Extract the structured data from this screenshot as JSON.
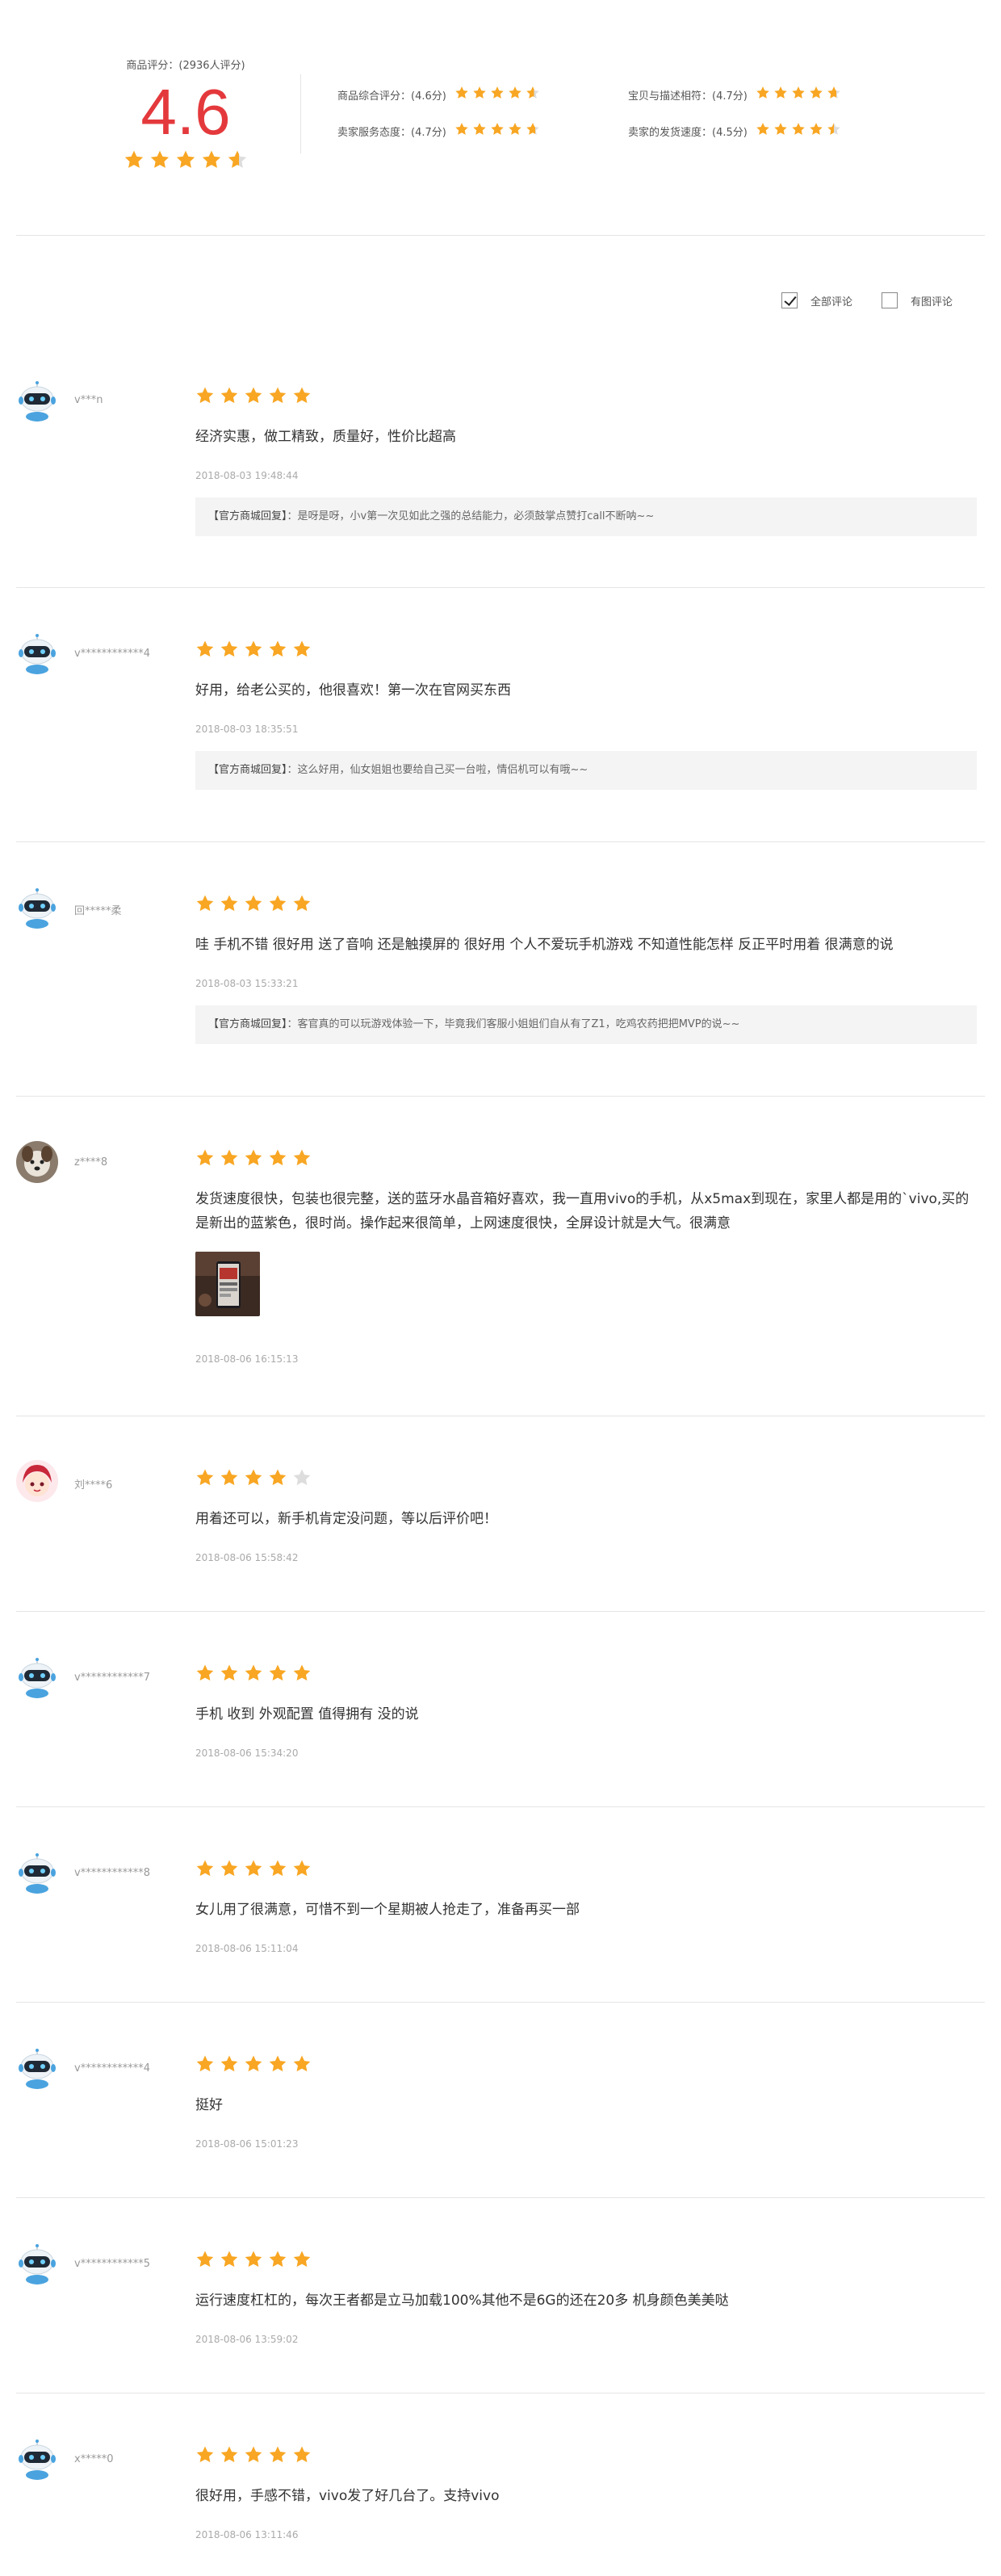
{
  "summary": {
    "label": "商品评分：(2936人评分)",
    "score": "4.6",
    "score_rating": 4.6,
    "metrics": [
      {
        "label": "商品综合评分：(4.6分)",
        "rating": 4.6
      },
      {
        "label": "宝贝与描述相符：(4.7分)",
        "rating": 4.7
      },
      {
        "label": "卖家服务态度：(4.7分)",
        "rating": 4.7
      },
      {
        "label": "卖家的发货速度：(4.5分)",
        "rating": 4.5
      }
    ]
  },
  "filters": {
    "all_label": "全部评论",
    "all_checked": true,
    "pic_label": "有图评论",
    "pic_checked": false
  },
  "reviews": [
    {
      "user": "v***n",
      "avatar": "robot",
      "rating": 5,
      "text": "经济实惠，做工精致，质量好，性价比超高",
      "time": "2018-08-03 19:48:44",
      "reply_tag": "【官方商城回复】",
      "reply_text": "：是呀是呀，小v第一次见如此之强的总结能力，必须鼓掌点赞打call不断呐~~"
    },
    {
      "user": "v************4",
      "avatar": "robot",
      "rating": 5,
      "text": "好用，给老公买的，他很喜欢！第一次在官网买东西",
      "time": "2018-08-03 18:35:51",
      "reply_tag": "【官方商城回复】",
      "reply_text": "：这么好用，仙女姐姐也要给自己买一台啦，情侣机可以有哦~~"
    },
    {
      "user": "回*****柔",
      "avatar": "robot",
      "rating": 5,
      "text": "哇 手机不错 很好用 送了音响 还是触摸屏的 很好用 个人不爱玩手机游戏 不知道性能怎样 反正平时用着 很满意的说",
      "time": "2018-08-03 15:33:21",
      "reply_tag": "【官方商城回复】",
      "reply_text": "：客官真的可以玩游戏体验一下，毕竟我们客服小姐姐们自从有了Z1，吃鸡农药把把MVP的说~~"
    },
    {
      "user": "z****8",
      "avatar": "photo-dog",
      "rating": 5,
      "text": "发货速度很快，包装也很完整，送的蓝牙水晶音箱好喜欢，我一直用vivo的手机，从x5max到现在，家里人都是用的`vivo,买的是新出的蓝紫色，很时尚。操作起来很简单，上网速度很快，全屏设计就是大气。很满意",
      "time": "2018-08-06 16:15:13"
    },
    {
      "user": "刘****6",
      "avatar": "anime",
      "rating": 4,
      "text": "用着还可以，新手机肯定没问题，等以后评价吧！",
      "time": "2018-08-06 15:58:42"
    },
    {
      "user": "v************7",
      "avatar": "robot",
      "rating": 5,
      "text": "手机 收到 外观配置 值得拥有 没的说",
      "time": "2018-08-06 15:34:20"
    },
    {
      "user": "v************8",
      "avatar": "robot",
      "rating": 5,
      "text": "女儿用了很满意，可惜不到一个星期被人抢走了，准备再买一部",
      "time": "2018-08-06 15:11:04"
    },
    {
      "user": "v************4",
      "avatar": "robot",
      "rating": 5,
      "text": "挺好",
      "time": "2018-08-06 15:01:23"
    },
    {
      "user": "v************5",
      "avatar": "robot",
      "rating": 5,
      "text": "运行速度杠杠的，每次王者都是立马加载100%其他不是6G的还在20多 机身颜色美美哒",
      "time": "2018-08-06 13:59:02"
    },
    {
      "user": "x*****0",
      "avatar": "robot",
      "rating": 5,
      "text": "很好用，手感不错，vivo发了好几台了。支持vivo",
      "time": "2018-08-06 13:11:46"
    }
  ],
  "colors": {
    "star": "#f8a623",
    "star_empty": "#dddddd",
    "score": "#e4393c"
  }
}
